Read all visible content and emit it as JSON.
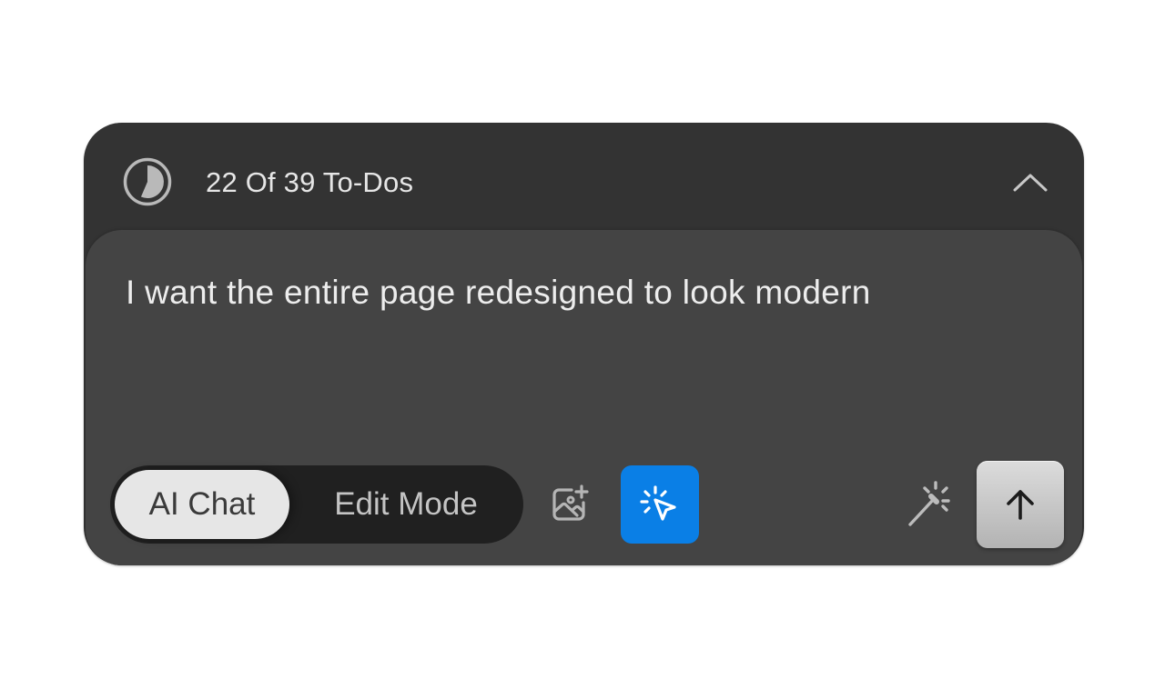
{
  "todo": {
    "label": "22 Of 39 To-Dos",
    "completed": 22,
    "total": 39
  },
  "composer": {
    "prompt": "I want the entire page redesigned to look modern"
  },
  "modes": {
    "active_label": "AI Chat",
    "inactive_label": "Edit Mode",
    "selected": "AI Chat"
  },
  "icons": {
    "progress": "progress-pie-icon",
    "collapse": "chevron-up-icon",
    "add_image": "image-add-icon",
    "select_element": "cursor-click-icon",
    "enhance": "magic-wand-icon",
    "send": "arrow-up-icon"
  },
  "colors": {
    "panel": "#333333",
    "composer": "#444444",
    "accent": "#0a7fe6",
    "toggle_track": "#202020",
    "toggle_active": "#e6e6e6"
  }
}
